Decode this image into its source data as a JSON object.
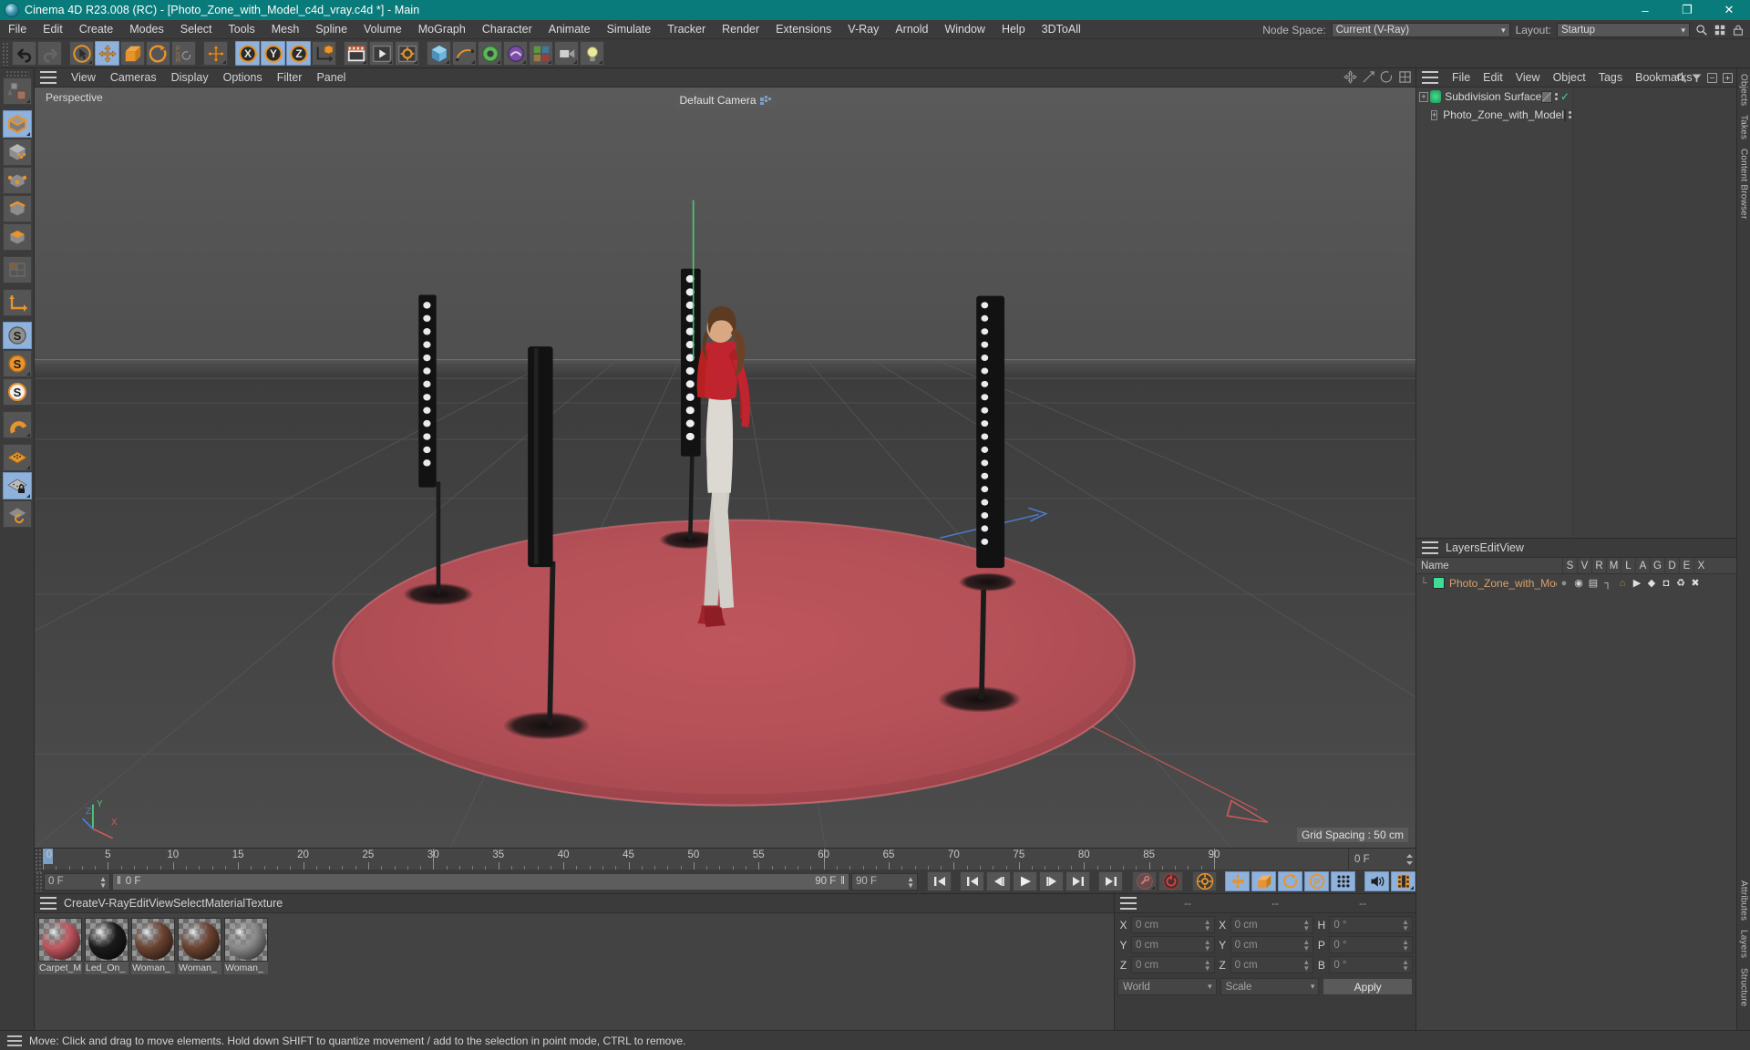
{
  "window": {
    "title": "Cinema 4D R23.008 (RC) - [Photo_Zone_with_Model_c4d_vray.c4d *] - Main",
    "minimize": "–",
    "maximize": "❐",
    "close": "✕"
  },
  "menubar": {
    "items": [
      "File",
      "Edit",
      "Create",
      "Modes",
      "Select",
      "Tools",
      "Mesh",
      "Spline",
      "Volume",
      "MoGraph",
      "Character",
      "Animate",
      "Simulate",
      "Tracker",
      "Render",
      "Extensions",
      "V-Ray",
      "Arnold",
      "Window",
      "Help",
      "3DToAll"
    ],
    "node_space_label": "Node Space:",
    "node_space_value": "Current (V-Ray)",
    "layout_label": "Layout:",
    "layout_value": "Startup"
  },
  "viewport": {
    "menu": [
      "View",
      "Cameras",
      "Display",
      "Options",
      "Filter",
      "Panel"
    ],
    "projection_label": "Perspective",
    "camera_label": "Default Camera",
    "grid_spacing": "Grid Spacing : 50 cm",
    "axis_x": "X",
    "axis_y": "Y",
    "axis_z": "Z"
  },
  "timeline": {
    "tick_labels": [
      "0",
      "5",
      "10",
      "15",
      "20",
      "25",
      "30",
      "35",
      "40",
      "45",
      "50",
      "55",
      "60",
      "65",
      "70",
      "75",
      "80",
      "85",
      "90"
    ],
    "current_frame_right": "0 F",
    "current_frame_field": "0 F",
    "range_start_field": "0 F",
    "range_end_label": "90 F",
    "range_end_field": "90 F",
    "min_frame": 0,
    "max_frame": 90
  },
  "material_manager": {
    "menu": [
      "Create",
      "V-Ray",
      "Edit",
      "View",
      "Select",
      "Material",
      "Texture"
    ],
    "materials": [
      {
        "name": "Carpet_M",
        "color": "#c0565e"
      },
      {
        "name": "Led_On_",
        "color": "#1a1a1a"
      },
      {
        "name": "Woman_",
        "color": "#6b4231"
      },
      {
        "name": "Woman_",
        "color": "#6b4231"
      },
      {
        "name": "Woman_",
        "color": "#8a8a8a"
      }
    ]
  },
  "coordinates": {
    "header_dashes": [
      "--",
      "--",
      "--"
    ],
    "rows": [
      {
        "label1": "X",
        "value1": "0 cm",
        "label2": "X",
        "value2": "0 cm",
        "label3": "H",
        "value3": "0 °"
      },
      {
        "label1": "Y",
        "value1": "0 cm",
        "label2": "Y",
        "value2": "0 cm",
        "label3": "P",
        "value3": "0 °"
      },
      {
        "label1": "Z",
        "value1": "0 cm",
        "label2": "Z",
        "value2": "0 cm",
        "label3": "B",
        "value3": "0 °"
      }
    ],
    "world_select": "World",
    "scale_select": "Scale",
    "apply_button": "Apply"
  },
  "object_manager": {
    "menu": [
      "File",
      "Edit",
      "View",
      "Object",
      "Tags",
      "Bookmarks"
    ],
    "items": [
      {
        "name": "Subdivision Surface",
        "tag_color": "#6b6b6b",
        "depth": 0,
        "checked": true
      },
      {
        "name": "Photo_Zone_with_Model",
        "tag_color": "#3ddc97",
        "depth": 1,
        "checked": false
      }
    ]
  },
  "layer_manager": {
    "menu": [
      "Layers",
      "Edit",
      "View"
    ],
    "name_header": "Name",
    "columns": [
      "S",
      "V",
      "R",
      "M",
      "L",
      "A",
      "G",
      "D",
      "E",
      "X"
    ],
    "rows": [
      {
        "name": "Photo_Zone_with_Model",
        "color": "#3ddc97"
      }
    ]
  },
  "side_tabs": [
    "Objects",
    "Takes",
    "Content Browser",
    "Attributes",
    "Layers",
    "Structure"
  ],
  "statusbar": {
    "message": "Move: Click and drag to move elements. Hold down SHIFT to quantize movement / add to the selection in point mode, CTRL to remove."
  },
  "colors": {
    "titlebar": "#0a7b7b",
    "accent_orange": "#e8932c",
    "active_blue": "#8fb2dd",
    "layer_green": "#3ddc97",
    "carpet_red": "#c0565e"
  }
}
